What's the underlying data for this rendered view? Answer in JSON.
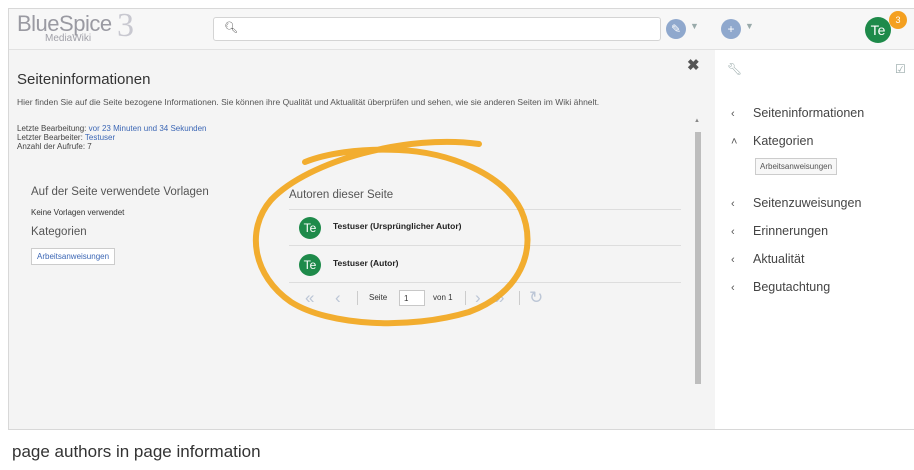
{
  "topbar": {
    "logo": "BlueSpice",
    "logo_sub": "MediaWiki",
    "logo_version": "3",
    "search_icon": "search-icon",
    "edit_icon": "pencil-icon",
    "add_icon": "plus-icon",
    "user_initials": "Te",
    "notifications": "3"
  },
  "dialog": {
    "title": "Seiteninformationen",
    "description": "Hier finden Sie auf die Seite bezogene Informationen. Sie können ihre Qualität und Aktualität überprüfen und sehen, wie sie anderen Seiten im Wiki ähnelt.",
    "last_edit_label": "Letzte Bearbeitung:",
    "last_edit_value": "vor 23 Minuten und 34 Sekunden",
    "last_editor_label": "Letzter Bearbeiter:",
    "last_editor_value": "Testuser",
    "views_label": "Anzahl der Aufrufe:",
    "views_value": "7",
    "templates_title": "Auf der Seite verwendete Vorlagen",
    "templates_empty": "Keine Vorlagen verwendet",
    "categories_title": "Kategorien",
    "category_chip": "Arbeitsanweisungen",
    "authors_title": "Autoren dieser Seite",
    "authors": [
      {
        "initials": "Te",
        "name": "Testuser (Ursprünglicher Autor)"
      },
      {
        "initials": "Te",
        "name": "Testuser (Autor)"
      }
    ],
    "pager": {
      "page_label": "Seite",
      "page_value": "1",
      "of_label": "von 1"
    }
  },
  "panel": {
    "items": [
      {
        "chevron": "‹",
        "label": "Seiteninformationen"
      },
      {
        "chevron": "˄",
        "label": "Kategorien"
      },
      {
        "chevron": "‹",
        "label": "Seitenzuweisungen"
      },
      {
        "chevron": "‹",
        "label": "Erinnerungen"
      },
      {
        "chevron": "‹",
        "label": "Aktualität"
      },
      {
        "chevron": "‹",
        "label": "Begutachtung"
      }
    ],
    "category_chip": "Arbeitsanweisungen"
  },
  "caption": "page authors in page information",
  "colors": {
    "accent": "#3c67b5",
    "avatar": "#1e8a4a",
    "highlight": "#f2a51a"
  }
}
